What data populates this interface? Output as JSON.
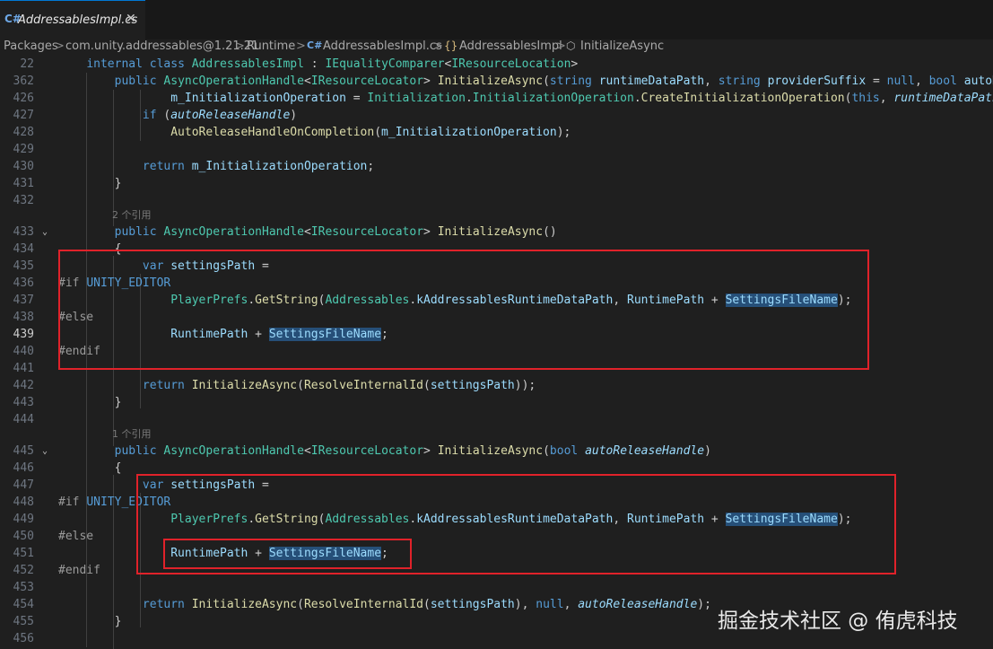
{
  "tab": {
    "icon": "C#",
    "filename": "AddressablesImpl.cs",
    "close": "✕"
  },
  "breadcrumb": {
    "items": [
      "Packages",
      "com.unity.addressables@1.21.21",
      "Runtime",
      "AddressablesImpl.cs",
      "AddressablesImpl",
      "InitializeAsync"
    ],
    "separator": ">"
  },
  "code": {
    "ref_hint_2": "2 个引用",
    "ref_hint_1": "1 个引用",
    "lines": [
      {
        "n": "22"
      },
      {
        "n": "362"
      },
      {
        "n": "426"
      },
      {
        "n": "427"
      },
      {
        "n": "428"
      },
      {
        "n": "429"
      },
      {
        "n": "430"
      },
      {
        "n": "431"
      },
      {
        "n": "432"
      },
      {
        "n": "433"
      },
      {
        "n": "434"
      },
      {
        "n": "435"
      },
      {
        "n": "436"
      },
      {
        "n": "437"
      },
      {
        "n": "438"
      },
      {
        "n": "439"
      },
      {
        "n": "440"
      },
      {
        "n": "441"
      },
      {
        "n": "442"
      },
      {
        "n": "443"
      },
      {
        "n": "444"
      },
      {
        "n": "445"
      },
      {
        "n": "446"
      },
      {
        "n": "447"
      },
      {
        "n": "448"
      },
      {
        "n": "449"
      },
      {
        "n": "450"
      },
      {
        "n": "451"
      },
      {
        "n": "452"
      },
      {
        "n": "453"
      },
      {
        "n": "454"
      },
      {
        "n": "455"
      },
      {
        "n": "456"
      }
    ]
  },
  "watermark": "掘金技术社区 @ 侑虎科技",
  "colors": {
    "accent": "#0078d4",
    "highlight_box": "#e0222a",
    "background": "#1f1f1f"
  }
}
